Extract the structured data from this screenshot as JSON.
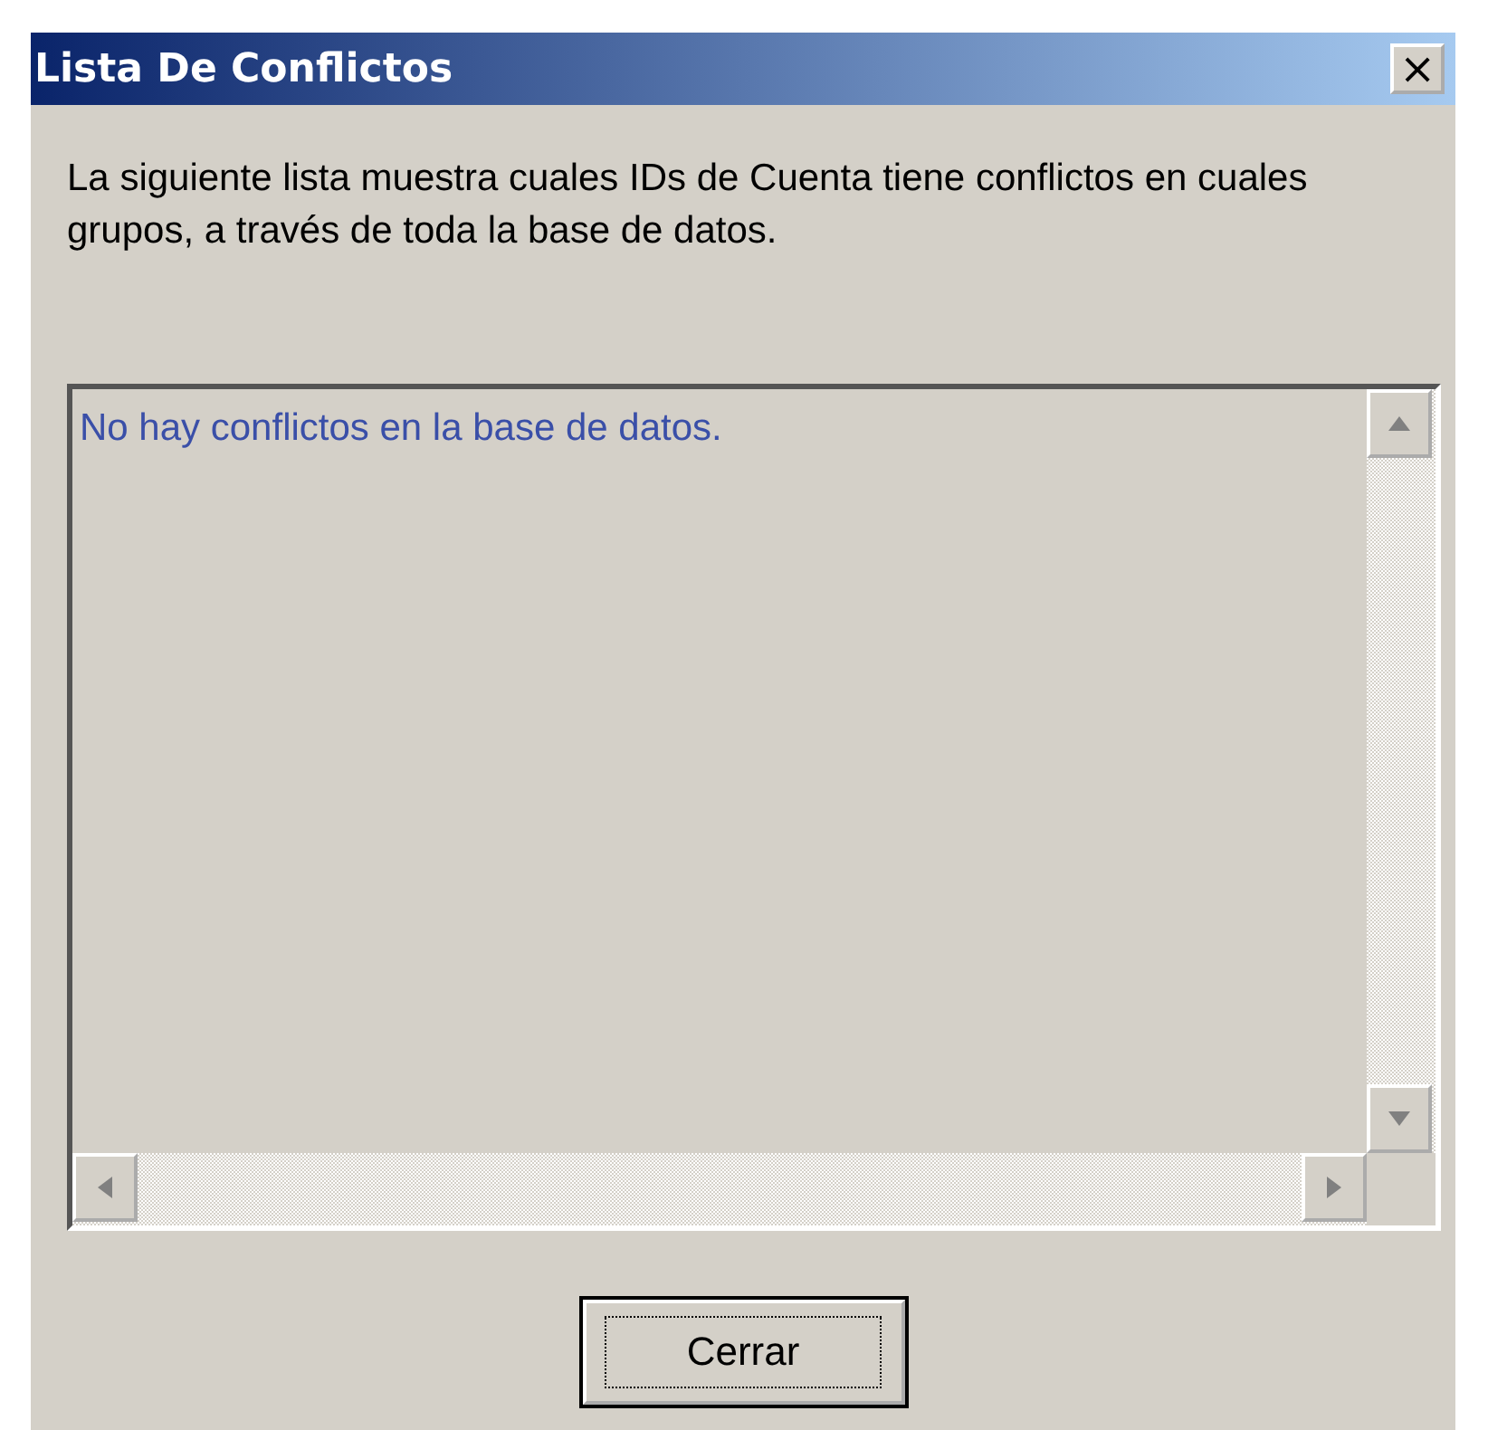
{
  "window": {
    "title": "Lista De Conflictos",
    "close_label": "×"
  },
  "description": "La siguiente lista muestra cuales IDs de Cuenta tiene conflictos en cuales grupos, a través de toda la base de datos.",
  "list": {
    "message": "No hay conflictos en la base de datos."
  },
  "buttons": [
    {
      "label": "Cerrar",
      "focused": true
    }
  ]
}
